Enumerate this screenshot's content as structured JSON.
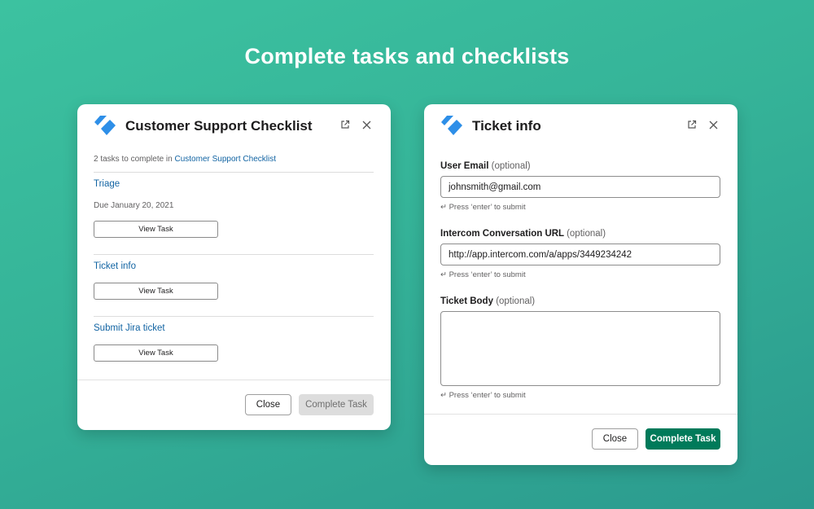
{
  "headline": "Complete tasks and checklists",
  "colors": {
    "accent_blue": "#1264a3",
    "primary_green": "#007a5a",
    "logo_blue": "#2e8fe8"
  },
  "left_modal": {
    "title": "Customer Support Checklist",
    "icons": {
      "logo": "workflow-logo-icon",
      "open": "external-link-icon",
      "close": "close-icon"
    },
    "subtitle_prefix": "2 tasks to complete in",
    "subtitle_link": "Customer Support Checklist",
    "tasks": [
      {
        "title": "Triage",
        "due": "Due January 20, 2021",
        "button": "View Task"
      },
      {
        "title": "Ticket info",
        "button": "View Task"
      },
      {
        "title": "Submit Jira ticket",
        "button": "View Task"
      }
    ],
    "close_label": "Close",
    "complete_label": "Complete Task"
  },
  "right_modal": {
    "title": "Ticket info",
    "icons": {
      "logo": "workflow-logo-icon",
      "open": "external-link-icon",
      "close": "close-icon"
    },
    "fields": [
      {
        "label": "User Email",
        "optional": "(optional)",
        "value": "johnsmith@gmail.com",
        "hint": "↵ Press ‘enter’ to submit"
      },
      {
        "label": "Intercom Conversation URL",
        "optional": "(optional)",
        "value": "http://app.intercom.com/a/apps/3449234242",
        "hint": "↵ Press ‘enter’ to submit"
      },
      {
        "label": "Ticket Body",
        "optional": "(optional)",
        "value": "",
        "hint": "↵ Press ‘enter’ to submit"
      }
    ],
    "close_label": "Close",
    "complete_label": "Complete Task"
  }
}
